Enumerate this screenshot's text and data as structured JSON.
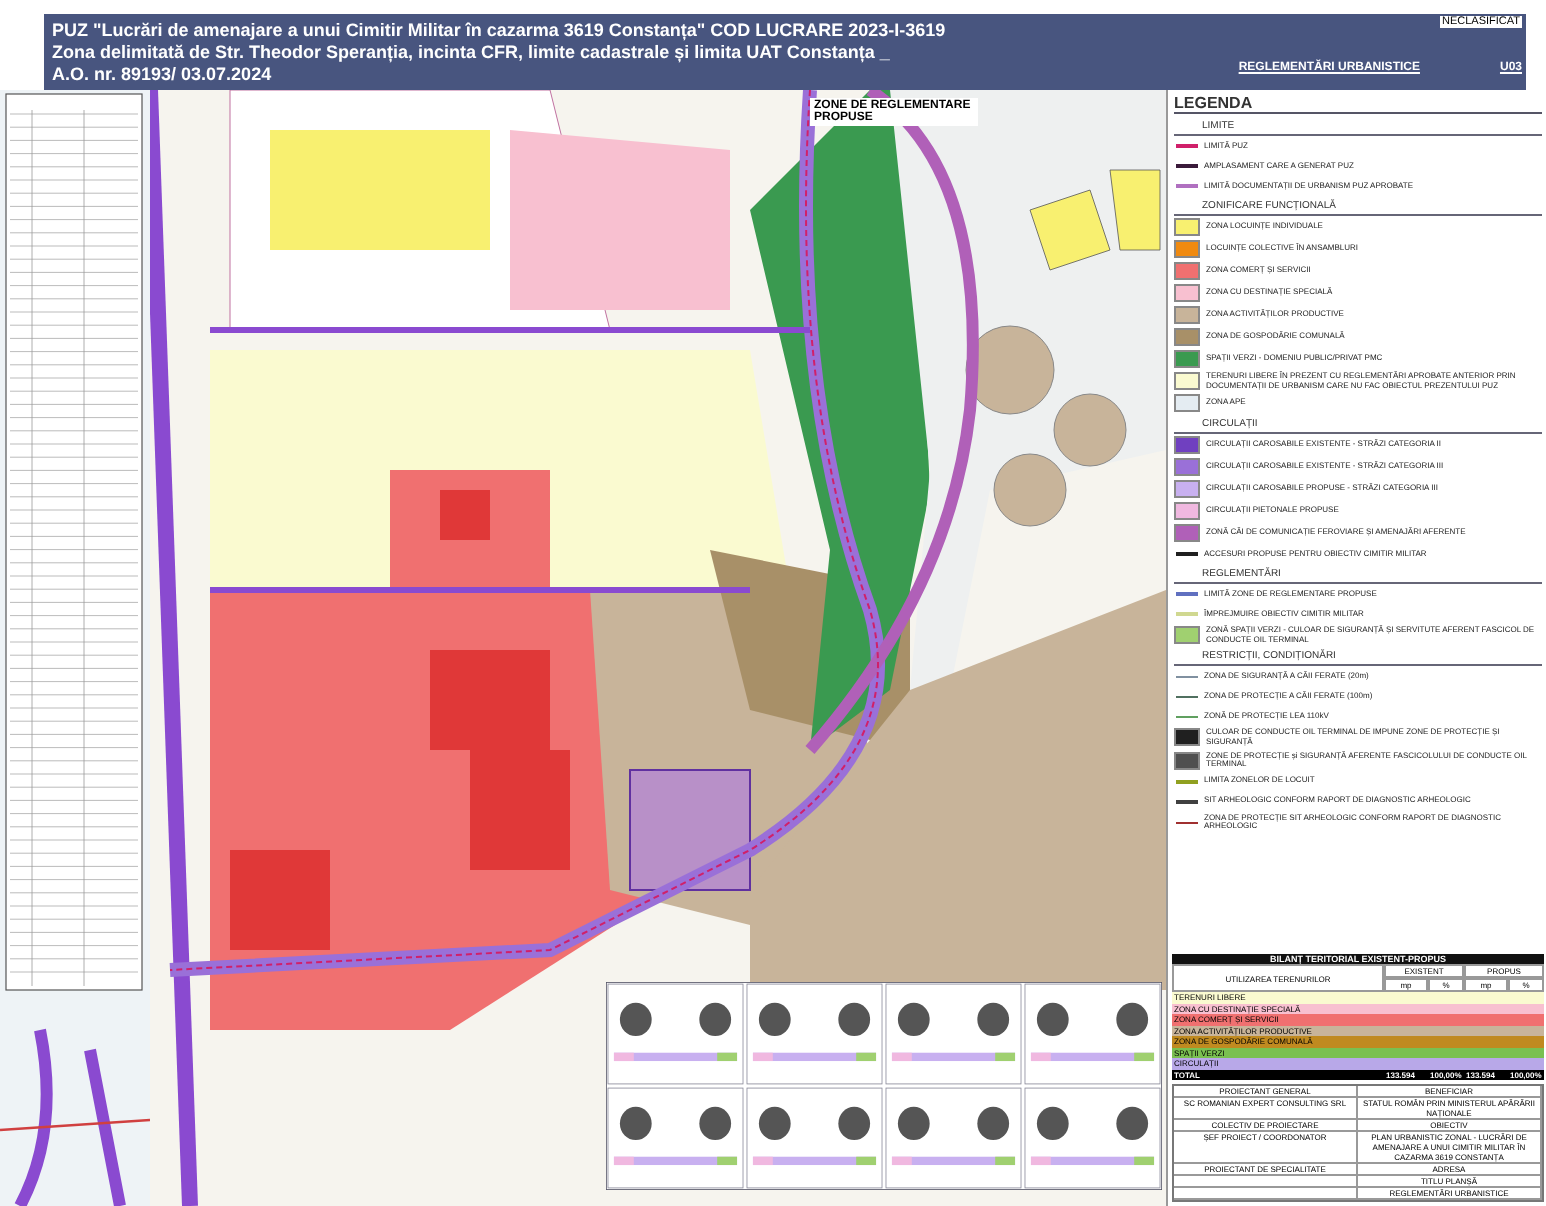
{
  "header": {
    "title_lines": [
      "PUZ \"Lucrări de amenajare a unui Cimitir Militar în cazarma 3619 Constanța\" COD LUCRARE 2023-I-3619",
      "Zona delimitată de Str. Theodor Speranția, incinta CFR, limite cadastrale și limita UAT Constanța _",
      "A.O. nr. 89193/ 03.07.2024"
    ],
    "sheet_title": "REGLEMENTĂRI URBANISTICE",
    "classification": "NECLASIFICAT",
    "sheet_code": "U03"
  },
  "map": {
    "zone_label": "ZONE DE REGLEMENTARE PROPUSE"
  },
  "legend": {
    "title": "LEGENDA",
    "sections": [
      {
        "heading": "LIMITE",
        "items": [
          {
            "kind": "line",
            "color": "#d0206a",
            "label": "LIMITĂ PUZ"
          },
          {
            "kind": "line",
            "color": "#3a1a3a",
            "label": "AMPLASAMENT CARE A GENERAT PUZ"
          },
          {
            "kind": "line",
            "color": "#b070c0",
            "label": "LIMITĂ DOCUMENTAȚII DE URBANISM PUZ APROBATE"
          }
        ]
      },
      {
        "heading": "ZONIFICARE FUNCȚIONALĂ",
        "items": [
          {
            "kind": "fill",
            "color": "#f8f070",
            "label": "ZONA LOCUINȚE INDIVIDUALE"
          },
          {
            "kind": "fill",
            "color": "#f08a10",
            "label": "LOCUINȚE COLECTIVE ÎN ANSAMBLURI"
          },
          {
            "kind": "fill",
            "color": "#f07070",
            "label": "ZONA COMERȚ ȘI SERVICII"
          },
          {
            "kind": "fill",
            "color": "#f8c0d0",
            "label": "ZONA CU DESTINAȚIE SPECIALĂ"
          },
          {
            "kind": "fill",
            "color": "#c8b49a",
            "label": "ZONA ACTIVITĂȚILOR PRODUCTIVE"
          },
          {
            "kind": "fill",
            "color": "#a89068",
            "label": "ZONA DE GOSPODĂRIE COMUNALĂ"
          },
          {
            "kind": "fill",
            "color": "#3a9a50",
            "label": "SPAȚII VERZI - DOMENIU PUBLIC/PRIVAT PMC"
          },
          {
            "kind": "fill",
            "color": "#fafad0",
            "label": "TERENURI LIBERE ÎN PREZENT CU REGLEMENTĂRI APROBATE ANTERIOR PRIN DOCUMENTAȚII DE URBANISM CARE NU FAC OBIECTUL PREZENTULUI PUZ"
          },
          {
            "kind": "fill",
            "color": "#e4ecf2",
            "label": "ZONA APE"
          }
        ]
      },
      {
        "heading": "CIRCULAȚII",
        "items": [
          {
            "kind": "fill",
            "color": "#7040c0",
            "label": "CIRCULAȚII CAROSABILE EXISTENTE - STRĂZI CATEGORIA II"
          },
          {
            "kind": "fill",
            "color": "#9a70d8",
            "label": "CIRCULAȚII CAROSABILE EXISTENTE - STRĂZI CATEGORIA III"
          },
          {
            "kind": "fill",
            "color": "#c8b0f0",
            "label": "CIRCULAȚII CAROSABILE PROPUSE - STRĂZI CATEGORIA III"
          },
          {
            "kind": "fill",
            "color": "#f0b8e0",
            "label": "CIRCULAȚII PIETONALE PROPUSE"
          },
          {
            "kind": "fill",
            "color": "#b060b8",
            "label": "ZONĂ CĂI DE COMUNICAȚIE FEROVIARE ȘI AMENAJĂRI AFERENTE"
          },
          {
            "kind": "line",
            "color": "#202020",
            "label": "ACCESURI PROPUSE PENTRU OBIECTIV CIMITIR MILITAR"
          }
        ]
      },
      {
        "heading": "REGLEMENTĂRI",
        "items": [
          {
            "kind": "line",
            "color": "#6070c0",
            "label": "LIMITĂ ZONE DE REGLEMENTARE PROPUSE"
          },
          {
            "kind": "line",
            "color": "#d0d890",
            "label": "ÎMPREJMUIRE OBIECTIV CIMITIR MILITAR"
          },
          {
            "kind": "fill",
            "color": "#a0d070",
            "label": "ZONĂ SPAȚII VERZI - CULOAR DE SIGURANȚĂ ȘI SERVITUTE AFERENT FASCICOL DE CONDUCTE OIL TERMINAL"
          }
        ]
      },
      {
        "heading": "RESTRICȚII, CONDIȚIONĂRI",
        "items": [
          {
            "kind": "line",
            "color": "#8090a0",
            "label": "ZONA DE SIGURANȚĂ A CĂII FERATE (20m)"
          },
          {
            "kind": "line",
            "color": "#507060",
            "label": "ZONA DE PROTECȚIE A CĂII FERATE (100m)"
          },
          {
            "kind": "line",
            "color": "#60a060",
            "label": "ZONĂ DE PROTECȚIE LEA 110kV"
          },
          {
            "kind": "fill",
            "color": "#202020",
            "label": "CULOAR DE CONDUCTE OIL TERMINAL DE IMPUNE ZONE DE PROTECȚIE ȘI SIGURANȚĂ"
          },
          {
            "kind": "fill",
            "color": "#505050",
            "label": "ZONE DE PROTECȚIE și SIGURANȚĂ AFERENTE FASCICOLULUI DE CONDUCTE OIL TERMINAL"
          },
          {
            "kind": "line",
            "color": "#90a020",
            "label": "LIMITA ZONELOR DE LOCUIT"
          },
          {
            "kind": "line",
            "color": "#404040",
            "label": "SIT ARHEOLOGIC CONFORM RAPORT DE DIAGNOSTIC ARHEOLOGIC"
          },
          {
            "kind": "line",
            "color": "#a03030",
            "label": "ZONA DE PROTECȚIE SIT ARHEOLOGIC CONFORM RAPORT DE DIAGNOSTIC ARHEOLOGIC"
          }
        ]
      }
    ]
  },
  "balance": {
    "title": "BILANȚ TERITORIAL EXISTENT-PROPUS",
    "label_header": "UTILIZAREA TERENURILOR",
    "groups": [
      "EXISTENT",
      "PROPUS"
    ],
    "units": [
      "mp",
      "%",
      "mp",
      "%"
    ],
    "rows": [
      {
        "label": "TERENURI LIBERE",
        "color": "#fafad0"
      },
      {
        "label": "ZONA CU DESTINAȚIE SPECIALĂ",
        "color": "#f8c0d0"
      },
      {
        "label": "ZONA COMERȚ ȘI SERVICII",
        "color": "#f07070"
      },
      {
        "label": "ZONA ACTIVITĂȚILOR PRODUCTIVE",
        "color": "#c8b49a"
      },
      {
        "label": "ZONA DE GOSPODĂRIE COMUNALĂ",
        "color": "#c08a20"
      },
      {
        "label": "SPAȚII VERZI",
        "color": "#7ac050"
      },
      {
        "label": "CIRCULAȚII",
        "color": "#b8a8e8"
      }
    ],
    "total_label": "TOTAL",
    "total_values": [
      "133.594",
      "100,00%",
      "133.594",
      "100,00%"
    ]
  },
  "title_block": {
    "rows": [
      [
        "PROIECTANT GENERAL",
        "BENEFICIAR"
      ],
      [
        "SC ROMANIAN EXPERT CONSULTING SRL",
        "STATUL ROMÂN PRIN MINISTERUL APĂRĂRII NAȚIONALE"
      ],
      [
        "COLECTIV DE PROIECTARE",
        "OBIECTIV"
      ],
      [
        "ȘEF PROIECT / COORDONATOR",
        "PLAN URBANISTIC ZONAL - LUCRĂRI DE AMENAJARE A UNUI CIMITIR MILITAR ÎN CAZARMA 3619 CONSTANȚA"
      ],
      [
        "PROIECTANT DE SPECIALITATE",
        "ADRESA"
      ],
      [
        "",
        "TITLU PLANȘĂ"
      ],
      [
        "",
        "REGLEMENTĂRI URBANISTICE"
      ]
    ]
  }
}
